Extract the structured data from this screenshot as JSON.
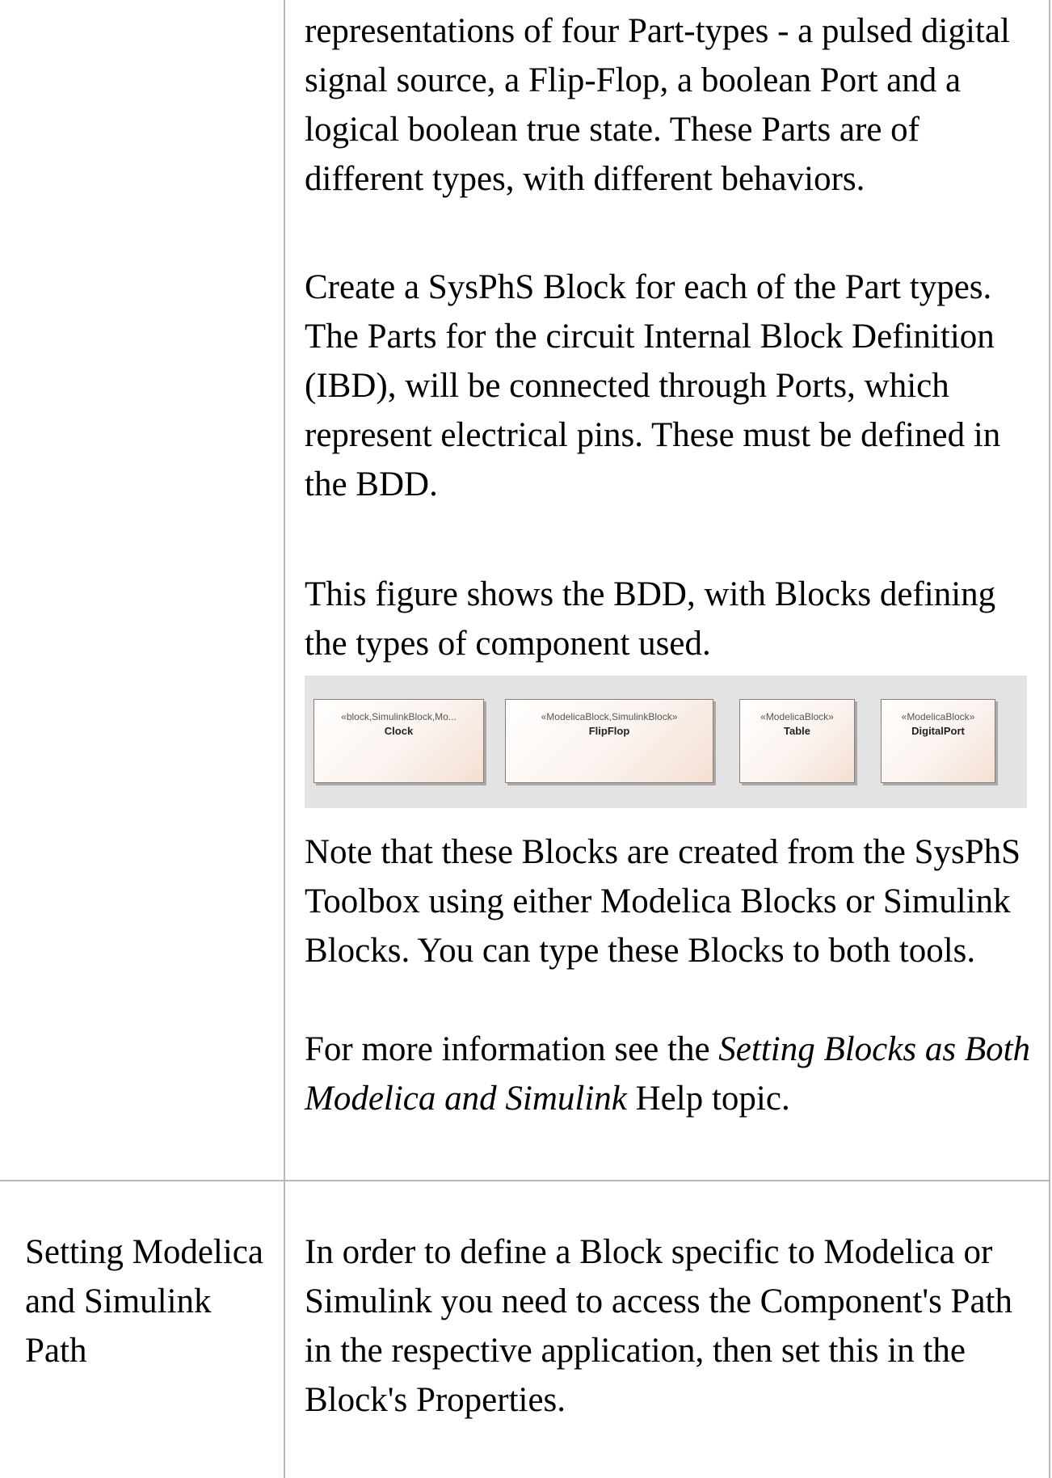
{
  "row1": {
    "p1": "representations of four Part-types - a pulsed digital signal source, a Flip-Flop, a boolean Port and a logical boolean true state. These Parts are of different types, with different behaviors.",
    "p2": "Create a SysPhS Block for each of the Part types. The Parts for the circuit Internal Block Definition (IBD), will be connected through Ports, which represent electrical pins. These must be defined in the BDD.",
    "p3": "This figure shows the BDD, with Blocks defining the types of component used.",
    "figure": {
      "blocks": [
        {
          "stereotype": "«block,SimulinkBlock,Mo...",
          "name": "Clock"
        },
        {
          "stereotype": "«ModelicaBlock,SimulinkBlock»",
          "name": "FlipFlop"
        },
        {
          "stereotype": "«ModelicaBlock»",
          "name": "Table"
        },
        {
          "stereotype": "«ModelicaBlock»",
          "name": "DigitalPort"
        }
      ]
    },
    "p4": "Note that these Blocks are created from the SysPhS Toolbox using either Modelica Blocks or Simulink Blocks. You can type these Blocks to both tools.",
    "p5_prefix": "For more information see the ",
    "p5_italic": "Setting Blocks as Both Modelica and Simulink",
    "p5_suffix": " Help topic."
  },
  "row2": {
    "label": "Setting Modelica and Simulink Path",
    "text": "In order to define a Block specific to Modelica or Simulink you need to access the Component's Path in the respective application, then set this in the Block's Properties."
  }
}
